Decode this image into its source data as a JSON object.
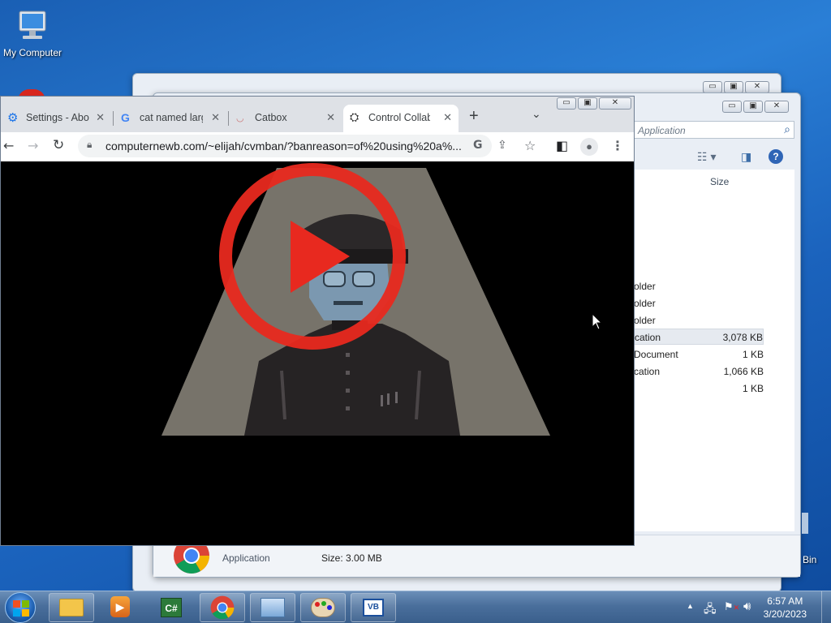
{
  "desktop": {
    "icons": [
      {
        "label": "My Computer"
      },
      {
        "label": "Bin"
      }
    ]
  },
  "explorer": {
    "search_placeholder": "Application",
    "columns": {
      "size": "Size"
    },
    "rows": [
      {
        "type": "older",
        "size": ""
      },
      {
        "type": "older",
        "size": ""
      },
      {
        "type": "older",
        "size": ""
      },
      {
        "type": "cation",
        "size": "3,078 KB"
      },
      {
        "type": "Document",
        "size": "1 KB"
      },
      {
        "type": "cation",
        "size": "1,066 KB"
      },
      {
        "type": "",
        "size": "1 KB"
      }
    ],
    "details": {
      "type": "Application",
      "size": "Size: 3.00 MB"
    }
  },
  "chrome": {
    "tabs": [
      {
        "title": "Settings - Abo",
        "close": "✕"
      },
      {
        "title": "cat named larg",
        "close": "✕"
      },
      {
        "title": "Catbox",
        "close": "✕"
      },
      {
        "title": "Control Collab",
        "close": "✕"
      }
    ],
    "new_tab": "+",
    "url": "computernewb.com/~elijah/cvmban/?banreason=of%20using%20a%...",
    "window_buttons": {
      "min": "▭",
      "max": "▣",
      "close": "✕"
    }
  },
  "taskbar": {
    "time": "6:57 AM",
    "date": "3/20/2023"
  },
  "colors": {
    "play_red": "#e8291f",
    "spotlight": "#77736a",
    "desktop_blue": "#1b63bd"
  }
}
